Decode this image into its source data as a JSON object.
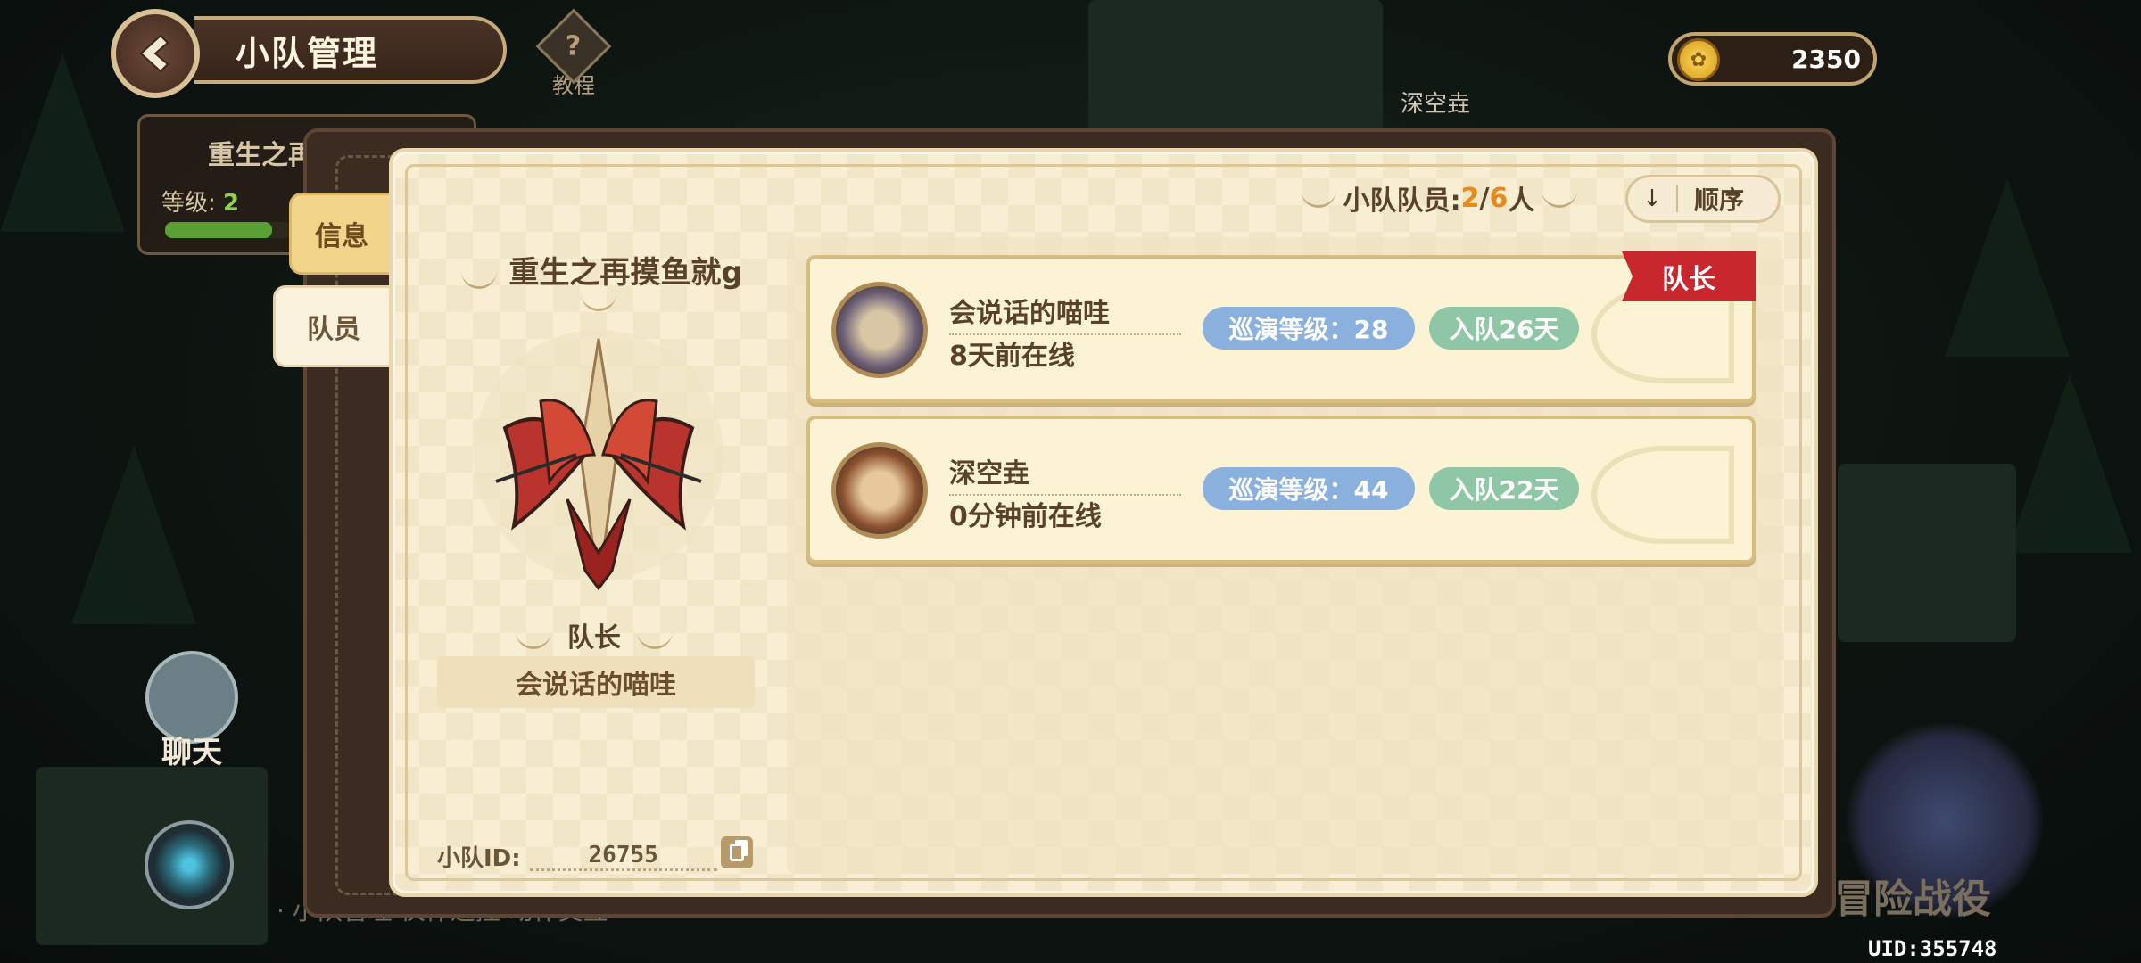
{
  "header": {
    "title": "小队管理",
    "tutorial_label": "教程",
    "tutorial_icon": "?"
  },
  "under_panel": {
    "team_name": "重生之再",
    "level_label": "等级:",
    "level_value": "2"
  },
  "currency": {
    "gold": "2350"
  },
  "background": {
    "player_name": "深空垚",
    "chat_label": "聊天",
    "bottom_hint": "· 小队管理 伙伴近控 动作交互",
    "adventure_label": "冒险战役",
    "uid": "UID:355748"
  },
  "tabs": {
    "info": "信息",
    "members": "队员"
  },
  "team": {
    "name": "重生之再摸鱼就g",
    "leader_heading": "队长",
    "leader_name": "会说话的喵哇",
    "id_label": "小队ID:",
    "id_value": "26755"
  },
  "members_header": {
    "label": "小队队员:",
    "current": "2",
    "sep": "/",
    "max": "6",
    "unit": "人",
    "sort_label": "顺序",
    "sort_icon": "↓"
  },
  "members": [
    {
      "name": "会说话的喵哇",
      "online": "8天前在线",
      "level": "巡演等级：28",
      "days": "入队26天",
      "tag": "队长"
    },
    {
      "name": "深空垚",
      "online": "0分钟前在线",
      "level": "巡演等级：44",
      "days": "入队22天"
    }
  ],
  "colors": {
    "leader_tag": "#c8282d",
    "level_pill": "#8ab0de",
    "days_pill": "#8fc6a5",
    "count_highlight": "#e68a1c"
  }
}
